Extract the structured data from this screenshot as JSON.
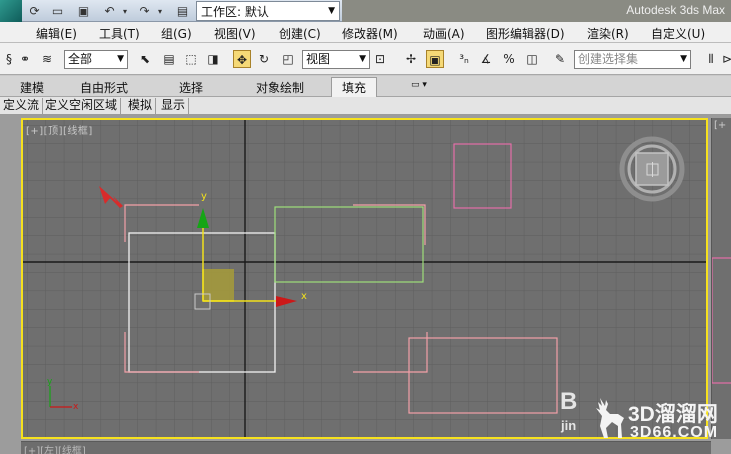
{
  "titlebar": {
    "workspace_label": "工作区: 默认",
    "app_title": "Autodesk 3ds Max"
  },
  "quick_access_icons": [
    "rotate-icon",
    "open-folder-icon",
    "save-icon",
    "undo-icon",
    "dropdown-arrow-icon",
    "redo-icon",
    "dropdown-arrow-icon",
    "project-folder-icon"
  ],
  "menu": [
    "编辑(E)",
    "工具(T)",
    "组(G)",
    "视图(V)",
    "创建(C)",
    "修改器(M)",
    "动画(A)",
    "图形编辑器(D)",
    "渲染(R)",
    "自定义(U)"
  ],
  "toolbar": {
    "filter_value": "全部",
    "coord_value": "视图",
    "selection_set_placeholder": "创建选择集"
  },
  "ribbon": {
    "tabs": [
      "建模",
      "自由形式",
      "选择",
      "对象绘制",
      "填充"
    ],
    "active_tab": "填充"
  },
  "subtabs": [
    "定义流",
    "定义空闲区域",
    "模拟",
    "显示"
  ],
  "viewport": {
    "label": "[+][顶][线框]",
    "right_label": "[+",
    "bottom_label": "[+][左][线框]",
    "gizmo_x_label": "x",
    "gizmo_y_label": "y",
    "axis_tripod_x": "x",
    "axis_tripod_y": "y"
  },
  "colors": {
    "viewport_bg": "#6f6f6f",
    "viewport_border": "#f6e11e",
    "grid": "#5e5e5e",
    "shape_white": "#f2f2f2",
    "shape_pink": "#e46ea8",
    "shape_green": "#9ee07a",
    "shape_salmon": "#f3a0a8",
    "gizmo_x": "#cc1818",
    "gizmo_y": "#15a515"
  },
  "watermark": {
    "brand": "3D溜溜网",
    "url": "3D66.COM",
    "baidu_prefix": "B",
    "baidu_suffix": "jin"
  }
}
